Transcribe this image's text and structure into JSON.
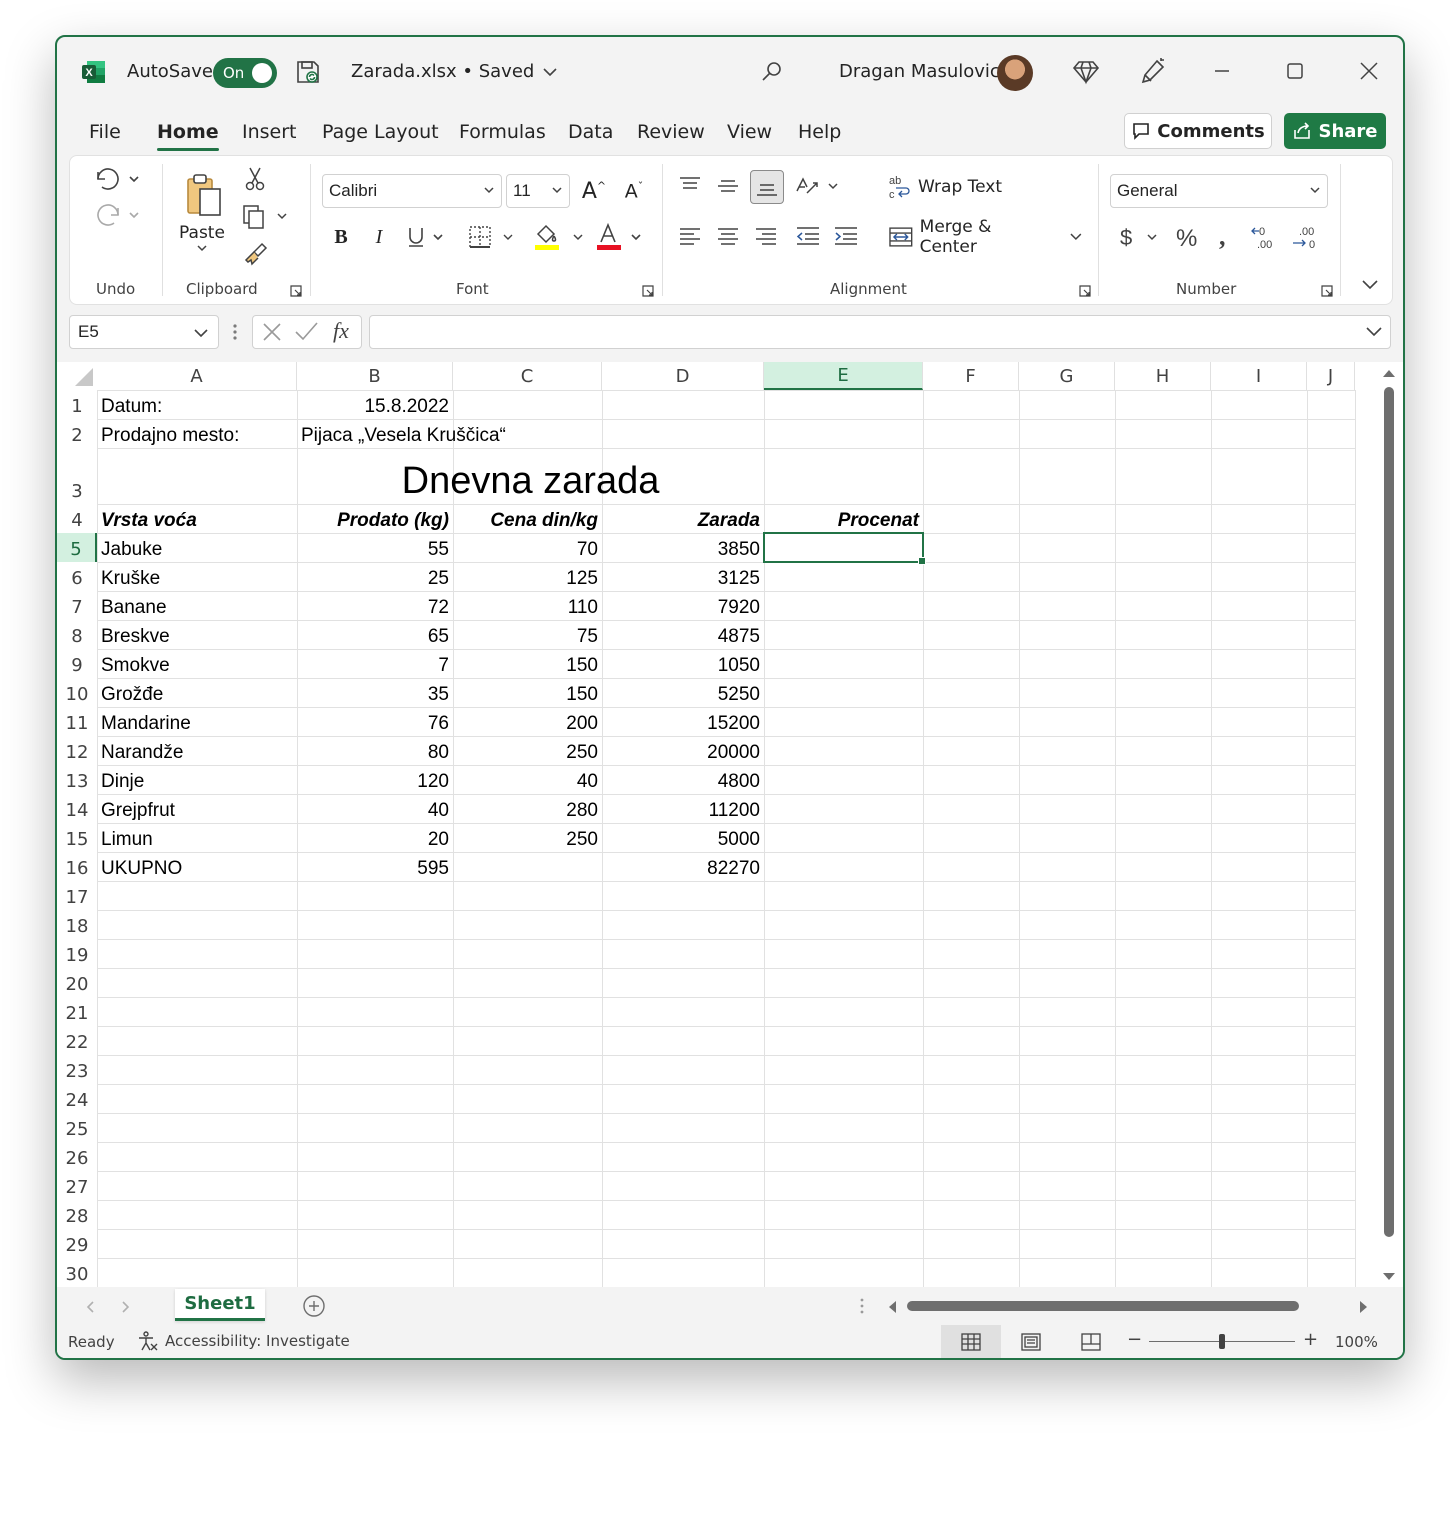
{
  "titlebar": {
    "autosave_label": "AutoSave",
    "autosave_state": "On",
    "filename": "Zarada.xlsx • Saved",
    "username": "Dragan Masulovic"
  },
  "menu": {
    "tabs": [
      {
        "label": "File"
      },
      {
        "label": "Home"
      },
      {
        "label": "Insert"
      },
      {
        "label": "Page Layout"
      },
      {
        "label": "Formulas"
      },
      {
        "label": "Data"
      },
      {
        "label": "Review"
      },
      {
        "label": "View"
      },
      {
        "label": "Help"
      }
    ],
    "comments_label": "Comments",
    "share_label": "Share"
  },
  "ribbon": {
    "groups": {
      "undo": "Undo",
      "clipboard": "Clipboard",
      "font": "Font",
      "alignment": "Alignment",
      "number": "Number"
    },
    "paste_label": "Paste",
    "font_name": "Calibri",
    "font_size": "11",
    "wrap_text_label": "Wrap Text",
    "merge_center_label": "Merge & Center",
    "number_format": "General",
    "accent_color": "#217346",
    "highlight_color": "#ffff00",
    "font_color": "#e81123"
  },
  "formula_bar": {
    "name_box": "E5",
    "fx_label": "fx",
    "formula": ""
  },
  "sheet": {
    "columns": [
      "A",
      "B",
      "C",
      "D",
      "E",
      "F",
      "G",
      "H",
      "I",
      "J"
    ],
    "rows": [
      "1",
      "2",
      "3",
      "4",
      "5",
      "6",
      "7",
      "8",
      "9",
      "10",
      "11",
      "12",
      "13",
      "14",
      "15",
      "16",
      "17",
      "18",
      "19",
      "20",
      "21",
      "22",
      "23",
      "24",
      "25",
      "26",
      "27",
      "28",
      "29",
      "30"
    ],
    "selected_cell": "E5",
    "datum_label": "Datum:",
    "datum_value": "15.8.2022",
    "mesto_label": "Prodajno mesto:",
    "mesto_value": "Pijaca „Vesela Kruščica“",
    "title": "Dnevna zarada",
    "headers": [
      "Vrsta voća",
      "Prodato (kg)",
      "Cena din/kg",
      "Zarada",
      "Procenat"
    ],
    "data": [
      [
        "Jabuke",
        "55",
        "70",
        "3850"
      ],
      [
        "Kruške",
        "25",
        "125",
        "3125"
      ],
      [
        "Banane",
        "72",
        "110",
        "7920"
      ],
      [
        "Breskve",
        "65",
        "75",
        "4875"
      ],
      [
        "Smokve",
        "7",
        "150",
        "1050"
      ],
      [
        "Grožđe",
        "35",
        "150",
        "5250"
      ],
      [
        "Mandarine",
        "76",
        "200",
        "15200"
      ],
      [
        "Narandže",
        "80",
        "250",
        "20000"
      ],
      [
        "Dinje",
        "120",
        "40",
        "4800"
      ],
      [
        "Grejpfrut",
        "40",
        "280",
        "11200"
      ],
      [
        "Limun",
        "20",
        "250",
        "5000"
      ]
    ],
    "total": [
      "UKUPNO",
      "595",
      "",
      "82270"
    ]
  },
  "sheet_tabs": {
    "active": "Sheet1"
  },
  "status": {
    "ready": "Ready",
    "accessibility": "Accessibility: Investigate",
    "zoom": "100%",
    "zoom_level": 1.0
  }
}
